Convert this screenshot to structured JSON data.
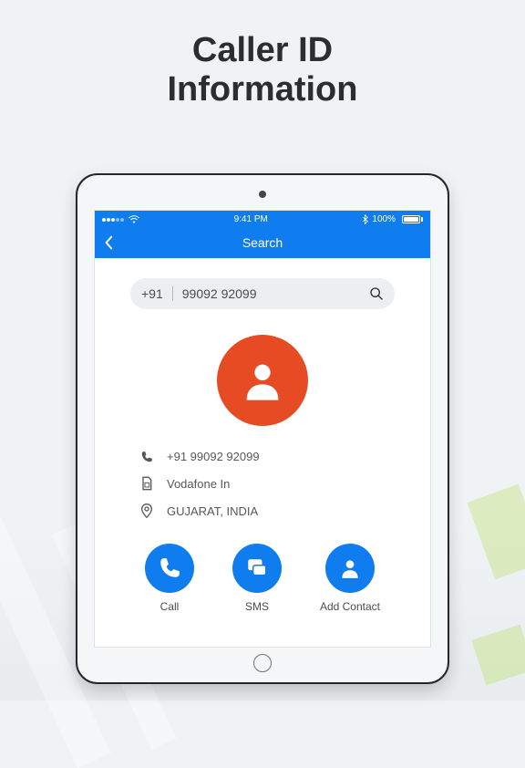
{
  "headline": {
    "line1": "Caller ID",
    "line2": "Information"
  },
  "statusBar": {
    "time": "9:41 PM",
    "batteryPct": "100%"
  },
  "nav": {
    "title": "Search"
  },
  "search": {
    "countryCode": "+91",
    "numberValue": "99092 92099"
  },
  "info": {
    "phone": "+91 99092 92099",
    "carrier": "Vodafone In",
    "location": "GUJARAT, INDIA"
  },
  "actions": {
    "call": "Call",
    "sms": "SMS",
    "addContact": "Add Contact"
  }
}
